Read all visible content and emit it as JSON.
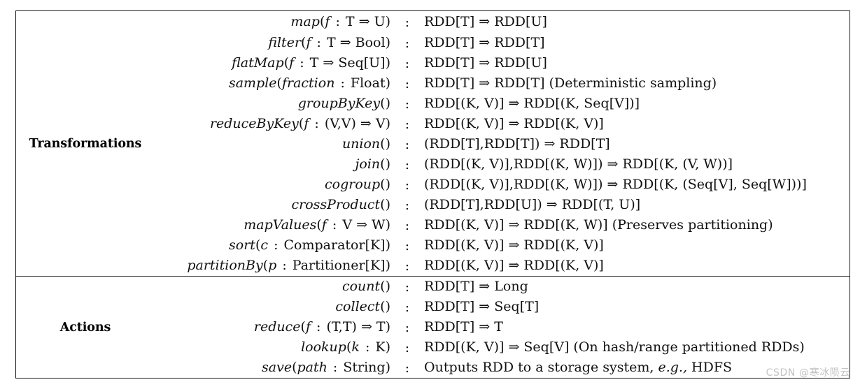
{
  "document": {
    "type": "rdd-api-table",
    "colon_separator": ":",
    "arrow": "⇒",
    "watermark": "CSDN @寒冰陨云"
  },
  "sections": [
    {
      "label": "Transformations",
      "rows": [
        {
          "signature": "map(f : T ⇒ U)",
          "type": "RDD[T] ⇒ RDD[U]"
        },
        {
          "signature": "filter(f : T ⇒ Bool)",
          "type": "RDD[T] ⇒ RDD[T]"
        },
        {
          "signature": "flatMap(f : T ⇒ Seq[U])",
          "type": "RDD[T] ⇒ RDD[U]"
        },
        {
          "signature": "sample(fraction : Float)",
          "type": "RDD[T] ⇒ RDD[T]  (Deterministic sampling)"
        },
        {
          "signature": "groupByKey()",
          "type": "RDD[(K, V)] ⇒ RDD[(K, Seq[V])]"
        },
        {
          "signature": "reduceByKey(f : (V,V) ⇒ V)",
          "type": "RDD[(K, V)] ⇒ RDD[(K, V)]"
        },
        {
          "signature": "union()",
          "type": "(RDD[T],RDD[T]) ⇒ RDD[T]"
        },
        {
          "signature": "join()",
          "type": "(RDD[(K, V)],RDD[(K, W)]) ⇒ RDD[(K, (V, W))]"
        },
        {
          "signature": "cogroup()",
          "type": "(RDD[(K, V)],RDD[(K, W)]) ⇒ RDD[(K, (Seq[V], Seq[W]))]"
        },
        {
          "signature": "crossProduct()",
          "type": "(RDD[T],RDD[U]) ⇒ RDD[(T, U)]"
        },
        {
          "signature": "mapValues(f : V ⇒ W)",
          "type": "RDD[(K, V)] ⇒ RDD[(K, W)]  (Preserves partitioning)"
        },
        {
          "signature": "sort(c : Comparator[K])",
          "type": "RDD[(K, V)] ⇒ RDD[(K, V)]"
        },
        {
          "signature": "partitionBy(p : Partitioner[K])",
          "type": "RDD[(K, V)] ⇒ RDD[(K, V)]"
        }
      ]
    },
    {
      "label": "Actions",
      "rows": [
        {
          "signature": "count()",
          "type": "RDD[T] ⇒ Long"
        },
        {
          "signature": "collect()",
          "type": "RDD[T] ⇒ Seq[T]"
        },
        {
          "signature": "reduce(f : (T,T) ⇒ T)",
          "type": "RDD[T] ⇒ T"
        },
        {
          "signature": "lookup(k : K)",
          "type": "RDD[(K, V)] ⇒ Seq[V]  (On hash/range partitioned RDDs)"
        },
        {
          "signature": "save(path : String)",
          "type": "Outputs RDD to a storage system, e.g., HDFS"
        }
      ]
    }
  ]
}
